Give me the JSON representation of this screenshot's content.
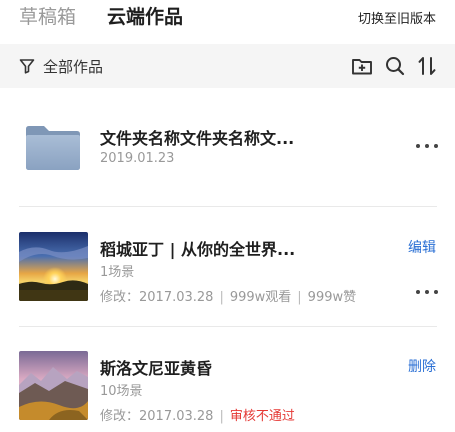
{
  "header": {
    "tab_drafts": "草稿箱",
    "tab_cloud": "云端作品",
    "switch_old": "切换至旧版本"
  },
  "filter": {
    "label": "全部作品",
    "icons": [
      "filter-icon",
      "new-folder-icon",
      "search-icon",
      "sort-icon"
    ]
  },
  "items": [
    {
      "type": "folder",
      "title": "文件夹名称文件夹名称文...",
      "date": "2019.01.23"
    },
    {
      "type": "work",
      "title": "稻城亚丁 | 从你的全世界...",
      "scenes": "1场景",
      "modified": "修改：2017.03.28",
      "views": "999w观看",
      "likes": "999w赞",
      "action": "编辑"
    },
    {
      "type": "work",
      "title": "斯洛文尼亚黄昏",
      "scenes": "10场景",
      "modified": "修改：2017.03.28",
      "status": "审核不通过",
      "action": "删除"
    }
  ],
  "colors": {
    "accent_link": "#2a6fd4",
    "status_error": "#e53935",
    "filterbar_bg": "#f5f5f5"
  }
}
